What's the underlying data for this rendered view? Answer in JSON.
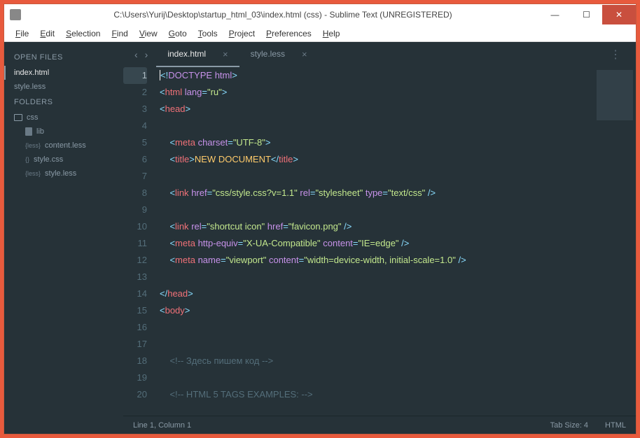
{
  "window": {
    "title": "C:\\Users\\Yurij\\Desktop\\startup_html_03\\index.html (css) - Sublime Text (UNREGISTERED)"
  },
  "menu": [
    "File",
    "Edit",
    "Selection",
    "Find",
    "View",
    "Goto",
    "Tools",
    "Project",
    "Preferences",
    "Help"
  ],
  "sidebar": {
    "openfiles_label": "OPEN FILES",
    "openfiles": [
      {
        "name": "index.html",
        "active": true
      },
      {
        "name": "style.less",
        "active": false
      }
    ],
    "folders_label": "FOLDERS",
    "root": "css",
    "tree": [
      {
        "name": "lib",
        "type": "folder",
        "depth": 1
      },
      {
        "name": "content.less",
        "type": "file",
        "prefix": "{less}",
        "depth": 1
      },
      {
        "name": "style.css",
        "type": "file",
        "prefix": "{}",
        "depth": 1
      },
      {
        "name": "style.less",
        "type": "file",
        "prefix": "{less}",
        "depth": 1
      }
    ]
  },
  "tabs": [
    {
      "label": "index.html",
      "active": true
    },
    {
      "label": "style.less",
      "active": false
    }
  ],
  "code_lines": [
    {
      "n": 1,
      "html": "<span class='c-punc'>&lt;!</span><span class='c-doctype'>DOCTYPE</span> <span class='c-doctype'>html</span><span class='c-punc'>&gt;</span>",
      "active": true
    },
    {
      "n": 2,
      "html": "<span class='c-punc'>&lt;</span><span class='c-tag'>html</span> <span class='c-attr'>lang</span><span class='c-punc'>=</span><span class='c-str'>\"ru\"</span><span class='c-punc'>&gt;</span>"
    },
    {
      "n": 3,
      "html": "<span class='c-punc'>&lt;</span><span class='c-tag'>head</span><span class='c-punc'>&gt;</span>"
    },
    {
      "n": 4,
      "html": ""
    },
    {
      "n": 5,
      "html": "    <span class='c-punc'>&lt;</span><span class='c-tag'>meta</span> <span class='c-attr'>charset</span><span class='c-punc'>=</span><span class='c-str'>\"UTF-8\"</span><span class='c-punc'>&gt;</span>"
    },
    {
      "n": 6,
      "html": "    <span class='c-punc'>&lt;</span><span class='c-tag'>title</span><span class='c-punc'>&gt;</span><span class='c-title'>NEW DOCUMENT</span><span class='c-punc'>&lt;/</span><span class='c-tag'>title</span><span class='c-punc'>&gt;</span>"
    },
    {
      "n": 7,
      "html": ""
    },
    {
      "n": 8,
      "html": "    <span class='c-punc'>&lt;</span><span class='c-tag'>link</span> <span class='c-attr'>href</span><span class='c-punc'>=</span><span class='c-str'>\"css/style.css?v=1.1\"</span> <span class='c-attr'>rel</span><span class='c-punc'>=</span><span class='c-str'>\"stylesheet\"</span> <span class='c-attr'>type</span><span class='c-punc'>=</span><span class='c-str'>\"text/css\"</span> <span class='c-punc'>/&gt;</span>"
    },
    {
      "n": 9,
      "html": ""
    },
    {
      "n": 10,
      "html": "    <span class='c-punc'>&lt;</span><span class='c-tag'>link</span> <span class='c-attr'>rel</span><span class='c-punc'>=</span><span class='c-str'>\"shortcut icon\"</span> <span class='c-attr'>href</span><span class='c-punc'>=</span><span class='c-str'>\"favicon.png\"</span> <span class='c-punc'>/&gt;</span>"
    },
    {
      "n": 11,
      "html": "    <span class='c-punc'>&lt;</span><span class='c-tag'>meta</span> <span class='c-attr'>http-equiv</span><span class='c-punc'>=</span><span class='c-str'>\"X-UA-Compatible\"</span> <span class='c-attr'>content</span><span class='c-punc'>=</span><span class='c-str'>\"IE=edge\"</span> <span class='c-punc'>/&gt;</span>"
    },
    {
      "n": 12,
      "html": "    <span class='c-punc'>&lt;</span><span class='c-tag'>meta</span> <span class='c-attr'>name</span><span class='c-punc'>=</span><span class='c-str'>\"viewport\"</span> <span class='c-attr'>content</span><span class='c-punc'>=</span><span class='c-str'>\"width=device-width, initial-scale=1.0\"</span> <span class='c-punc'>/&gt;</span>"
    },
    {
      "n": 13,
      "html": ""
    },
    {
      "n": 14,
      "html": "<span class='c-punc'>&lt;/</span><span class='c-tag'>head</span><span class='c-punc'>&gt;</span>"
    },
    {
      "n": 15,
      "html": "<span class='c-punc'>&lt;</span><span class='c-tag'>body</span><span class='c-punc'>&gt;</span>"
    },
    {
      "n": 16,
      "html": ""
    },
    {
      "n": 17,
      "html": ""
    },
    {
      "n": 18,
      "html": "    <span class='c-comment'>&lt;!-- Здесь пишем код --&gt;</span>"
    },
    {
      "n": 19,
      "html": ""
    },
    {
      "n": 20,
      "html": "    <span class='c-comment'>&lt;!-- HTML 5 TAGS EXAMPLES: --&gt;</span>"
    }
  ],
  "status": {
    "left": "Line 1, Column 1",
    "tabsize": "Tab Size: 4",
    "lang": "HTML"
  }
}
